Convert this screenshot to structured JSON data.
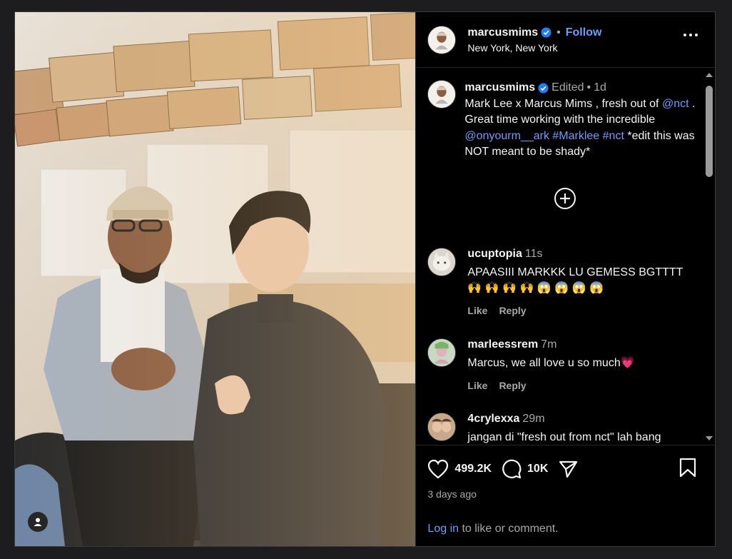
{
  "post": {
    "username": "marcusmims",
    "follow_label": "Follow",
    "location": "New York, New York",
    "separator": "•"
  },
  "caption": {
    "username": "marcusmims",
    "edited": "Edited",
    "sep": "•",
    "time": "1d",
    "text_1": "Mark Lee x Marcus Mims , fresh out of ",
    "mention_1": "@nct",
    "text_2": " . Great time working with the incredible ",
    "mention_2": "@onyourm__ark",
    "text_3": " ",
    "hashtag_1": "#Marklee",
    "text_4": " ",
    "hashtag_2": "#nct",
    "text_5": " *edit this was NOT meant to be shady*"
  },
  "comments": [
    {
      "username": "ucuptopia",
      "time": "11s",
      "text": "APAASIII MARKKK LU GEMESS BGTTTT",
      "emoji": "🙌 🙌 🙌 🙌 😱 😱 😱 😱",
      "like": "Like",
      "reply": "Reply"
    },
    {
      "username": "marleessrem",
      "time": "7m",
      "text": "Marcus, we all love u so much",
      "emoji": "💗",
      "like": "Like",
      "reply": "Reply"
    },
    {
      "username": "4crylexxa",
      "time": "29m",
      "text": "jangan di \"fresh out from nct\" lah bang"
    }
  ],
  "stats": {
    "likes": "499.2K",
    "comments": "10K",
    "date": "3 days ago"
  },
  "login": {
    "link": "Log in",
    "rest": " to like or comment."
  },
  "colors": {
    "link": "#6f9cff",
    "verified": "#1f7ef0",
    "background": "#000000"
  },
  "icons": [
    "verified-icon",
    "more-icon",
    "plus-circle-icon",
    "heart-icon",
    "comment-icon",
    "share-icon",
    "bookmark-icon",
    "tagged-user-icon"
  ]
}
